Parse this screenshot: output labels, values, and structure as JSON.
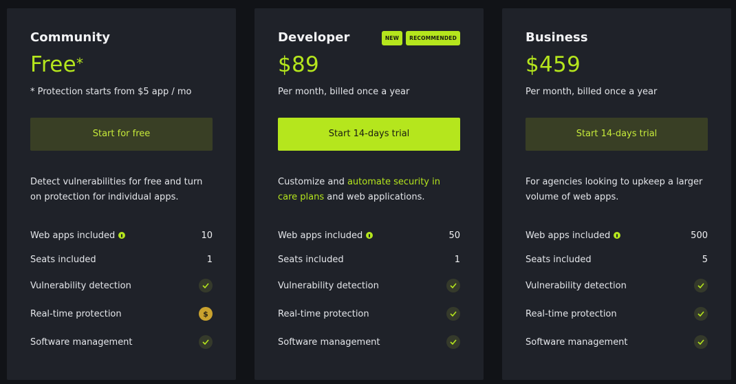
{
  "plans": [
    {
      "name": "Community",
      "badges": [],
      "price": "Free",
      "price_suffix": "*",
      "price_note": "* Protection starts from $5 app / mo",
      "cta": "Start for free",
      "description": "Detect vulnerabilities for free and turn on protection for individual apps.",
      "features": {
        "web_apps_label": "Web apps included",
        "web_apps_value": "10",
        "seats_label": "Seats included",
        "seats_value": "1",
        "vuln_label": "Vulnerability detection",
        "vuln_status": "check",
        "realtime_label": "Real-time protection",
        "realtime_status": "paid",
        "software_label": "Software management",
        "software_status": "check"
      }
    },
    {
      "name": "Developer",
      "badges": [
        "NEW",
        "RECOMMENDED"
      ],
      "price": "$89",
      "price_note": "Per month, billed once a year",
      "cta": "Start 14-days trial",
      "description_pre": "Customize and ",
      "description_link": "automate security in care plans",
      "description_post": " and web applications.",
      "features": {
        "web_apps_label": "Web apps included",
        "web_apps_value": "50",
        "seats_label": "Seats included",
        "seats_value": "1",
        "vuln_label": "Vulnerability detection",
        "vuln_status": "check",
        "realtime_label": "Real-time protection",
        "realtime_status": "check",
        "software_label": "Software management",
        "software_status": "check"
      }
    },
    {
      "name": "Business",
      "badges": [],
      "price": "$459",
      "price_note": "Per month, billed once a year",
      "cta": "Start 14-days trial",
      "description": "For agencies looking to upkeep a larger volume of web apps.",
      "features": {
        "web_apps_label": "Web apps included",
        "web_apps_value": "500",
        "seats_label": "Seats included",
        "seats_value": "5",
        "vuln_label": "Vulnerability detection",
        "vuln_status": "check",
        "realtime_label": "Real-time protection",
        "realtime_status": "check",
        "software_label": "Software management",
        "software_status": "check"
      }
    }
  ],
  "icons": {
    "info": "info-icon",
    "check": "check-icon",
    "paid": "dollar-icon",
    "dollar_glyph": "$"
  },
  "colors": {
    "accent": "#b5e61d",
    "card_bg": "#1f2229",
    "page_bg": "#111317",
    "muted_button_bg": "#393f25",
    "paid_icon": "#c9a22e"
  }
}
